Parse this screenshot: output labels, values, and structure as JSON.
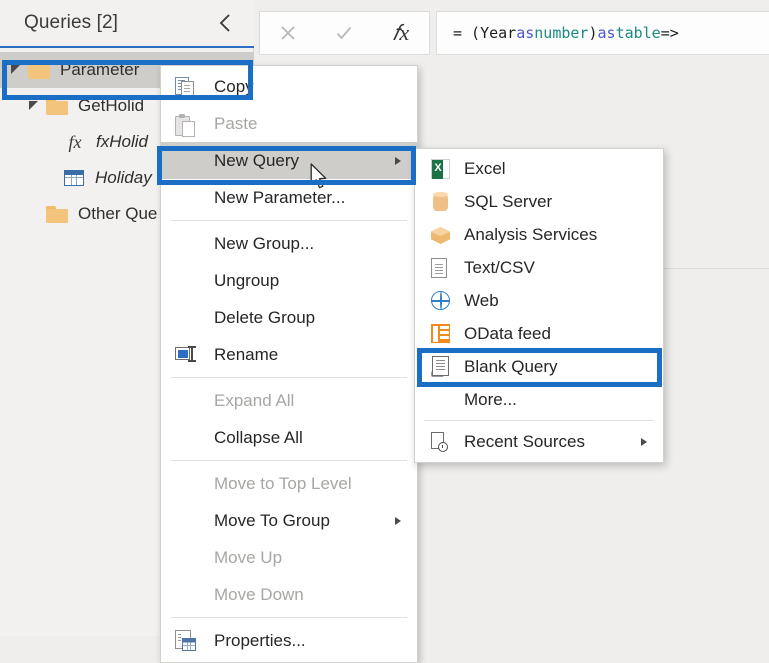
{
  "app": {
    "left_panel_title": "Queries [2]",
    "collapse_icon": "chevron-left-icon",
    "section_heading_visible_text": "ter"
  },
  "formula_bar": {
    "cancel_icon": "close-icon",
    "confirm_icon": "check-icon",
    "fx_icon": "fx-icon",
    "formula_tokens": [
      {
        "text": "= (Year ",
        "kind": "plain"
      },
      {
        "text": "as ",
        "kind": "keyword"
      },
      {
        "text": "number",
        "kind": "type"
      },
      {
        "text": ") ",
        "kind": "plain"
      },
      {
        "text": "as ",
        "kind": "keyword"
      },
      {
        "text": "table ",
        "kind": "type"
      },
      {
        "text": "=>",
        "kind": "plain"
      }
    ],
    "formula_text": "= (Year as number) as table =>"
  },
  "query_tree": {
    "items": [
      {
        "label": "Parameter",
        "icon": "folder-icon",
        "indent": 0,
        "expanded": true,
        "selected": true,
        "italic": false
      },
      {
        "label": "GetHolid",
        "icon": "folder-icon",
        "indent": 1,
        "expanded": true,
        "selected": false,
        "italic": false
      },
      {
        "label": "fxHolid",
        "icon": "fx-icon",
        "indent": 2,
        "expanded": false,
        "selected": false,
        "italic": true
      },
      {
        "label": "Holiday",
        "icon": "table-icon",
        "indent": 2,
        "expanded": false,
        "selected": false,
        "italic": true
      },
      {
        "label": "Other Que",
        "icon": "folder-icon",
        "indent": 1,
        "expanded": false,
        "selected": false,
        "italic": false
      }
    ]
  },
  "context_menu": {
    "items": [
      {
        "label": "Copy",
        "icon": "copy-icon",
        "disabled": false,
        "highlighted": false,
        "submenu": false
      },
      {
        "label": "Paste",
        "icon": "paste-icon",
        "disabled": true,
        "highlighted": false,
        "submenu": false
      },
      {
        "label": "New Query",
        "icon": "none",
        "disabled": false,
        "highlighted": true,
        "submenu": true
      },
      {
        "label": "New Parameter...",
        "icon": "none",
        "disabled": false,
        "highlighted": false,
        "submenu": false
      },
      {
        "label": "New Group...",
        "icon": "none",
        "disabled": false,
        "highlighted": false,
        "submenu": false
      },
      {
        "label": "Ungroup",
        "icon": "none",
        "disabled": false,
        "highlighted": false,
        "submenu": false
      },
      {
        "label": "Delete Group",
        "icon": "none",
        "disabled": false,
        "highlighted": false,
        "submenu": false
      },
      {
        "label": "Rename",
        "icon": "rename-icon",
        "disabled": false,
        "highlighted": false,
        "submenu": false
      },
      {
        "label": "Expand All",
        "icon": "none",
        "disabled": true,
        "highlighted": false,
        "submenu": false
      },
      {
        "label": "Collapse All",
        "icon": "none",
        "disabled": false,
        "highlighted": false,
        "submenu": false
      },
      {
        "label": "Move to Top Level",
        "icon": "none",
        "disabled": true,
        "highlighted": false,
        "submenu": false
      },
      {
        "label": "Move To Group",
        "icon": "none",
        "disabled": false,
        "highlighted": false,
        "submenu": true
      },
      {
        "label": "Move Up",
        "icon": "none",
        "disabled": true,
        "highlighted": false,
        "submenu": false
      },
      {
        "label": "Move Down",
        "icon": "none",
        "disabled": true,
        "highlighted": false,
        "submenu": false
      },
      {
        "label": "Properties...",
        "icon": "properties-icon",
        "disabled": false,
        "highlighted": false,
        "submenu": false
      }
    ]
  },
  "new_query_submenu": {
    "items": [
      {
        "label": "Excel",
        "icon": "excel-icon",
        "submenu": false
      },
      {
        "label": "SQL Server",
        "icon": "sql-server-icon",
        "submenu": false
      },
      {
        "label": "Analysis Services",
        "icon": "analysis-services-icon",
        "submenu": false
      },
      {
        "label": "Text/CSV",
        "icon": "text-csv-icon",
        "submenu": false
      },
      {
        "label": "Web",
        "icon": "globe-icon",
        "submenu": false
      },
      {
        "label": "OData feed",
        "icon": "odata-icon",
        "submenu": false
      },
      {
        "label": "Blank Query",
        "icon": "blank-query-icon",
        "submenu": false
      },
      {
        "label": "More...",
        "icon": "none",
        "submenu": false
      },
      {
        "label": "Recent Sources",
        "icon": "recent-sources-icon",
        "submenu": true
      }
    ]
  },
  "annotations": {
    "color": "#1A6EC4",
    "boxes": [
      {
        "target": "Parameter"
      },
      {
        "target": "New Query"
      },
      {
        "target": "Blank Query"
      }
    ]
  },
  "colors": {
    "accent_blue": "#1A6EC4",
    "panel_bg": "#F2F1EF",
    "canvas_bg": "#EFEEEC",
    "menu_bg": "#FFFFFF",
    "highlight_gray": "#CFCDC9",
    "folder_orange": "#F3C57C",
    "excel_green": "#1E7145",
    "odata_orange": "#F08A1E"
  }
}
